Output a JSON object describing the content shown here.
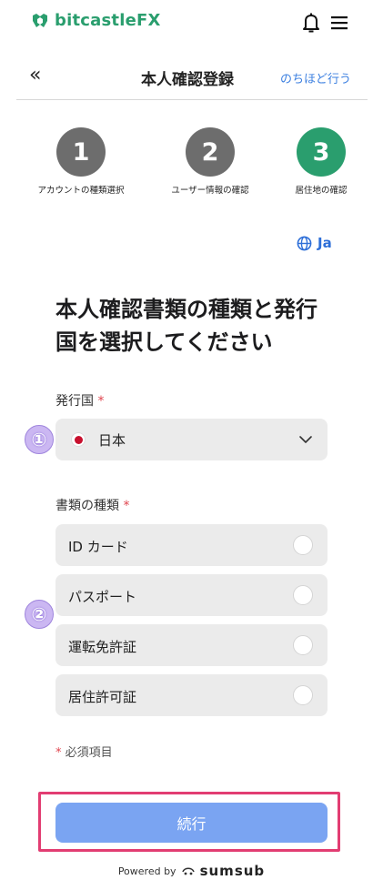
{
  "header": {
    "logo_text": "bitcastle",
    "logo_suffix": "FX",
    "brand_color": "#2a9e6e"
  },
  "nav": {
    "back_label": "«",
    "title": "本人確認登録",
    "later_label": "のちほど行う"
  },
  "steps": [
    {
      "number": "1",
      "label": "アカウントの種類選択",
      "state": "done"
    },
    {
      "number": "2",
      "label": "ユーザー情報の確認",
      "state": "done"
    },
    {
      "number": "3",
      "label": "居住地の確認",
      "state": "active"
    }
  ],
  "language": {
    "label": "Ja"
  },
  "heading": "本人確認書類の種類と発行国を選択してください",
  "country": {
    "label": "発行国",
    "required_mark": "*",
    "selected": "日本"
  },
  "doc_type": {
    "label": "書類の種類",
    "required_mark": "*",
    "options": [
      "ID カード",
      "パスポート",
      "運転免許証",
      "居住許可証"
    ]
  },
  "badges": [
    "①",
    "②"
  ],
  "required_note": {
    "mark": "*",
    "text": "必須項目"
  },
  "continue_label": "続行",
  "footer": {
    "powered_by": "Powered by",
    "brand": "sumsub"
  },
  "colors": {
    "accent": "#2a9e6e",
    "link": "#3b7fe0",
    "button": "#7aa4f2",
    "highlight": "#e23d72",
    "required": "#e0454f"
  }
}
